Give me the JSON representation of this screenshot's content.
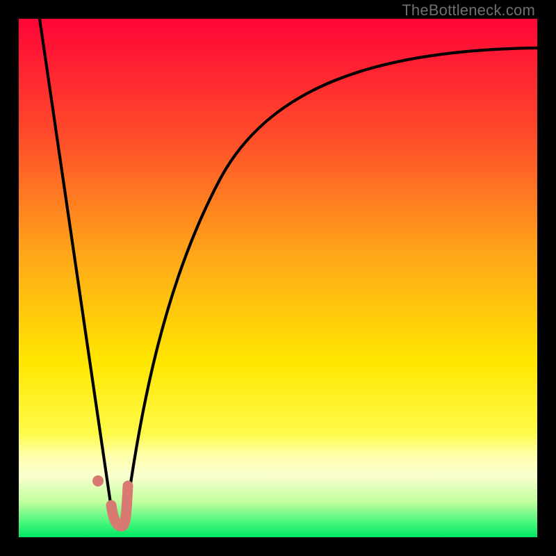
{
  "watermark": "TheBottleneck.com",
  "chart_data": {
    "type": "line",
    "title": "",
    "xlabel": "",
    "ylabel": "",
    "xlim": [
      0,
      100
    ],
    "ylim": [
      0,
      100
    ],
    "grid": false,
    "series": [
      {
        "name": "left-branch",
        "x": [
          4,
          7.5,
          10.5,
          13.5,
          16.5,
          18.2
        ],
        "y": [
          100,
          80,
          60,
          40,
          20,
          3
        ]
      },
      {
        "name": "right-branch",
        "x": [
          20.5,
          22,
          24,
          26,
          28.5,
          32,
          37,
          44,
          53,
          65,
          80,
          100
        ],
        "y": [
          3,
          15,
          28,
          40,
          52,
          63,
          73,
          81,
          86.5,
          90.5,
          93,
          94.3
        ]
      }
    ],
    "highlight": {
      "name": "bottom-hook",
      "color": "#d97a72",
      "points": [
        {
          "x": 15.3,
          "y": 11
        },
        {
          "x": 17.8,
          "y": 6
        },
        {
          "x": 18.5,
          "y": 2.3
        },
        {
          "x": 19.8,
          "y": 2.3
        },
        {
          "x": 20.5,
          "y": 2.3
        },
        {
          "x": 20.7,
          "y": 6
        },
        {
          "x": 21.0,
          "y": 10
        }
      ]
    },
    "background_gradient": {
      "top": "#ff0437",
      "mid1": "#ff7d1d",
      "mid2": "#ffe600",
      "band": "#ffffa5",
      "bottom": "#00e863"
    }
  }
}
